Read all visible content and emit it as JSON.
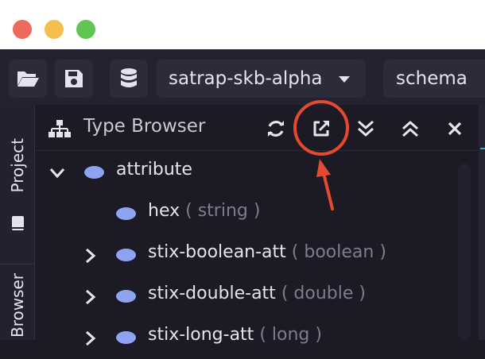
{
  "window": {
    "traffic_lights": [
      "close",
      "minimize",
      "zoom"
    ]
  },
  "toolbar": {
    "open_icon": "folder-open-icon",
    "save_icon": "save-icon",
    "database_icon": "database-icon",
    "database_select": "satrap-skb-alpha",
    "schema_select": "schema"
  },
  "sidebar": {
    "tabs": [
      {
        "label": "Project",
        "icon": "book-icon"
      },
      {
        "label": "Browser"
      }
    ]
  },
  "type_browser": {
    "title": "Type Browser",
    "header_buttons": [
      "refresh-icon",
      "open-external-icon",
      "expand-all-icon",
      "collapse-all-icon",
      "close-icon"
    ],
    "tree": [
      {
        "name": "attribute",
        "type": "",
        "expanded": true,
        "level": 0
      },
      {
        "name": "hex",
        "type": "( string )",
        "level": 1
      },
      {
        "name": "stix-boolean-att",
        "type": "( boolean )",
        "level": 1
      },
      {
        "name": "stix-double-att",
        "type": "( double )",
        "level": 1
      },
      {
        "name": "stix-long-att",
        "type": "( long )",
        "level": 1
      }
    ]
  },
  "annotation": {
    "color": "#e34a2e"
  }
}
